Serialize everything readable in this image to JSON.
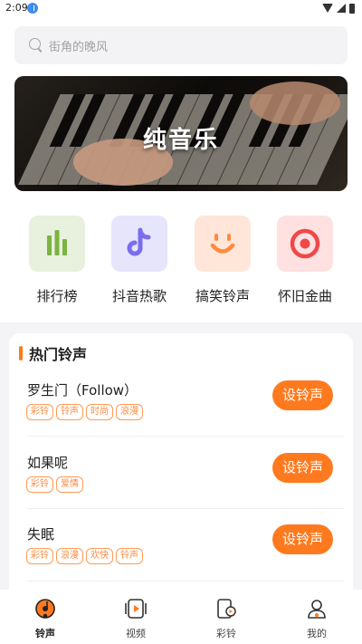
{
  "status_bar": {
    "time": "2:09"
  },
  "search": {
    "placeholder": "街角的晚风"
  },
  "banner": {
    "title": "纯音乐"
  },
  "categories": [
    {
      "label": "排行榜",
      "icon": "chart-bars-icon",
      "tile_color": "#e7f1dd",
      "icon_color": "#7cb342"
    },
    {
      "label": "抖音热歌",
      "icon": "tiktok-note-icon",
      "tile_color": "#e6e5fb",
      "icon_color": "#7a6df0"
    },
    {
      "label": "搞笑铃声",
      "icon": "smile-icon",
      "tile_color": "#ffe6d8",
      "icon_color": "#ff8a3d"
    },
    {
      "label": "怀旧金曲",
      "icon": "record-target-icon",
      "tile_color": "#ffe1e1",
      "icon_color": "#f04848"
    }
  ],
  "hot": {
    "title": "热门铃声",
    "action_label": "设铃声",
    "songs": [
      {
        "title": "罗生门（Follow）",
        "tags": [
          "彩铃",
          "铃声",
          "时尚",
          "浪漫"
        ]
      },
      {
        "title": "如果呢",
        "tags": [
          "彩铃",
          "爱情"
        ]
      },
      {
        "title": "失眠",
        "tags": [
          "彩铃",
          "浪漫",
          "欢快",
          "铃声"
        ]
      }
    ]
  },
  "nav": [
    {
      "label": "铃声",
      "icon": "music-disc-icon",
      "active": true
    },
    {
      "label": "视频",
      "icon": "video-play-icon",
      "active": false
    },
    {
      "label": "彩铃",
      "icon": "phone-ring-icon",
      "active": false
    },
    {
      "label": "我的",
      "icon": "profile-icon",
      "active": false
    }
  ],
  "colors": {
    "accent": "#ff7a1f",
    "background": "#f4f4f6"
  }
}
